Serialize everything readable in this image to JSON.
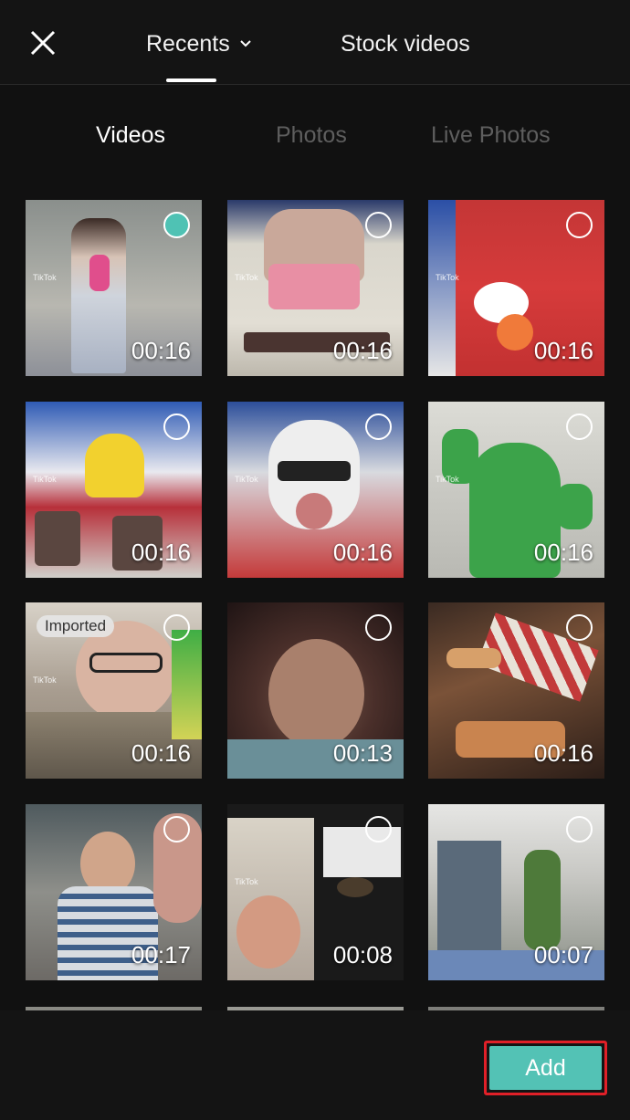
{
  "header": {
    "close_icon": "close-icon",
    "tabs": [
      {
        "label": "Recents",
        "active": true,
        "icon": "chevron-down-icon"
      },
      {
        "label": "Stock videos",
        "active": false
      }
    ]
  },
  "media_tabs": [
    {
      "label": "Videos",
      "active": true
    },
    {
      "label": "Photos",
      "active": false
    },
    {
      "label": "Live Photos",
      "active": false
    }
  ],
  "items": [
    {
      "duration": "00:16",
      "selected": true,
      "badge": "",
      "tiktok": true
    },
    {
      "duration": "00:16",
      "selected": false,
      "badge": "",
      "tiktok": true
    },
    {
      "duration": "00:16",
      "selected": false,
      "badge": "",
      "tiktok": true
    },
    {
      "duration": "00:16",
      "selected": false,
      "badge": "",
      "tiktok": true
    },
    {
      "duration": "00:16",
      "selected": false,
      "badge": "",
      "tiktok": true
    },
    {
      "duration": "00:16",
      "selected": false,
      "badge": "",
      "tiktok": true
    },
    {
      "duration": "00:16",
      "selected": false,
      "badge": "Imported",
      "tiktok": true
    },
    {
      "duration": "00:13",
      "selected": false,
      "badge": "",
      "tiktok": false
    },
    {
      "duration": "00:16",
      "selected": false,
      "badge": "",
      "tiktok": false
    },
    {
      "duration": "00:17",
      "selected": false,
      "badge": "",
      "tiktok": false
    },
    {
      "duration": "00:08",
      "selected": false,
      "badge": "",
      "tiktok": true
    },
    {
      "duration": "00:07",
      "selected": false,
      "badge": "",
      "tiktok": false
    }
  ],
  "tiktok_label": "TikTok",
  "footer": {
    "add_label": "Add"
  },
  "colors": {
    "accent": "#53c2b5",
    "highlight_outline": "#e02028",
    "background": "#111111"
  }
}
